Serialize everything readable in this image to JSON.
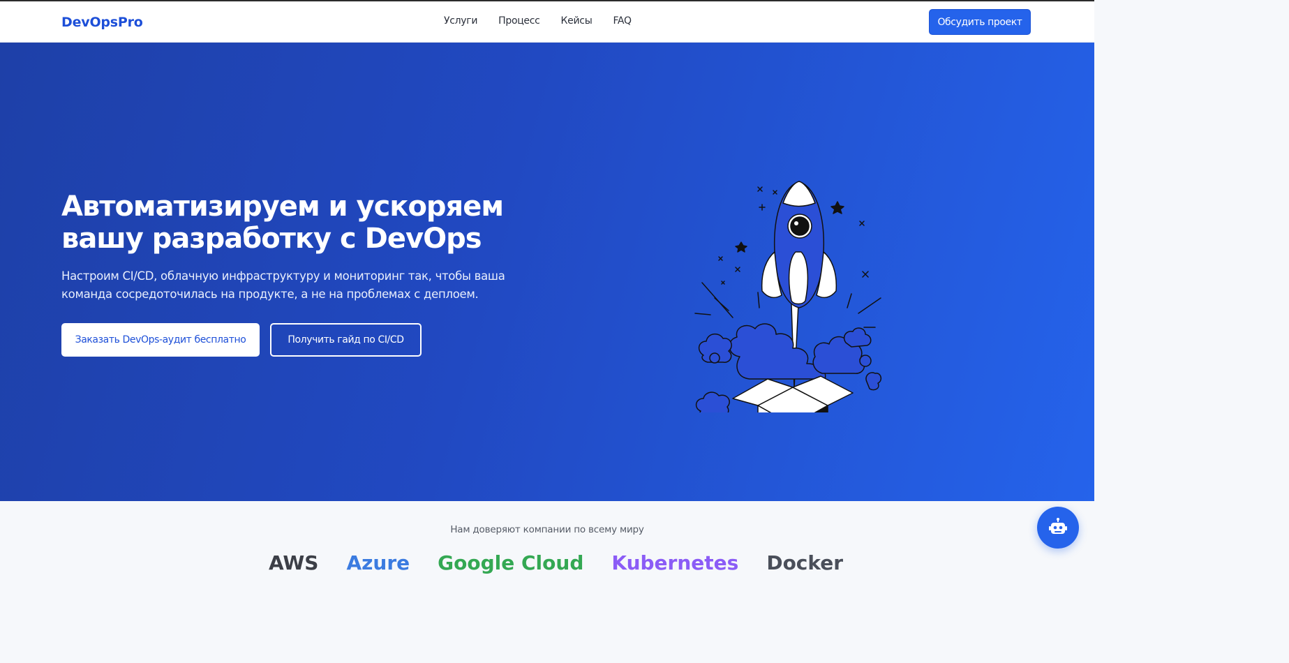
{
  "header": {
    "logo": "DevOpsPro",
    "nav": [
      "Услуги",
      "Процесс",
      "Кейсы",
      "FAQ"
    ],
    "cta": "Обсудить проект"
  },
  "hero": {
    "title_line1": "Автоматизируем и ускоряем",
    "title_line2": "вашу разработку с DevOps",
    "subtitle_line1": "Настроим CI/CD, облачную инфраструктуру и мониторинг так, чтобы ваша",
    "subtitle_line2": "команда сосредоточилась на продукте, а не на проблемах с деплоем.",
    "primary_button": "Заказать DevOps-аудит бесплатно",
    "secondary_button": "Получить гайд по CI/CD",
    "illustration": "rocket-launch-from-box-icon"
  },
  "trust": {
    "title": "Нам доверяют компании по всему миру",
    "logos": [
      {
        "name": "AWS",
        "color": "#3c3f47"
      },
      {
        "name": "Azure",
        "color": "#3b7be0"
      },
      {
        "name": "Google Cloud",
        "color": "#34a853"
      },
      {
        "name": "Kubernetes",
        "color": "#8b5cf6"
      },
      {
        "name": "Docker",
        "color": "#4a4f5a"
      }
    ]
  },
  "chat": {
    "icon": "robot-icon"
  },
  "colors": {
    "brand": "#1d4fd8",
    "accent": "#2563eb",
    "hero_gradient_start": "#1e40a8",
    "hero_gradient_end": "#2563eb"
  }
}
